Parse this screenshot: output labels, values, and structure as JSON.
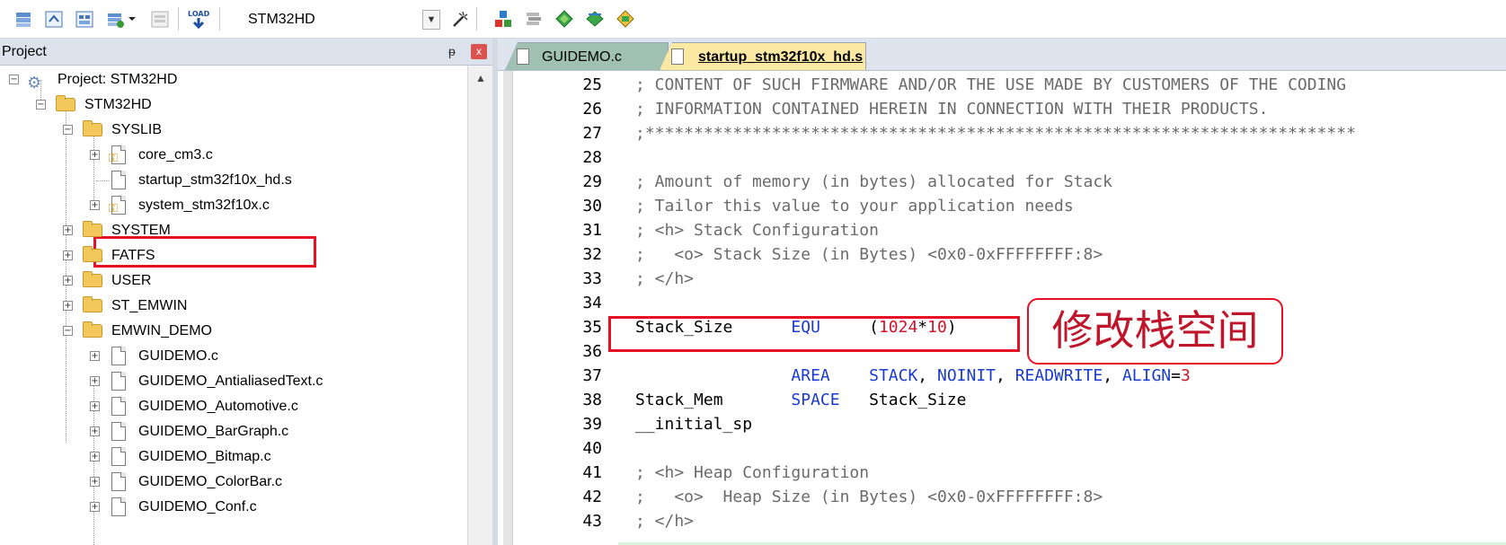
{
  "toolbar": {
    "target_name": "STM32HD",
    "load_label": "LOAD",
    "icons": [
      "batch-build-icon",
      "translate-icon",
      "build-icon",
      "rebuild-icon",
      "stop-build-icon",
      "download-icon",
      "options-wand-icon",
      "manage-components-icon",
      "manage-books-icon",
      "pack-installer-icon",
      "select-packs-icon",
      "run-time-env-icon"
    ]
  },
  "project_panel": {
    "title": "Project",
    "pin_glyph": "ᵽ",
    "close_glyph": "x",
    "tree": [
      {
        "label": "Project: STM32HD"
      },
      {
        "label": "STM32HD"
      },
      {
        "label": "SYSLIB"
      },
      {
        "label": "core_cm3.c"
      },
      {
        "label": "startup_stm32f10x_hd.s"
      },
      {
        "label": "system_stm32f10x.c"
      },
      {
        "label": "SYSTEM"
      },
      {
        "label": "FATFS"
      },
      {
        "label": "USER"
      },
      {
        "label": "ST_EMWIN"
      },
      {
        "label": "EMWIN_DEMO"
      },
      {
        "label": "GUIDEMO.c"
      },
      {
        "label": "GUIDEMO_AntialiasedText.c"
      },
      {
        "label": "GUIDEMO_Automotive.c"
      },
      {
        "label": "GUIDEMO_BarGraph.c"
      },
      {
        "label": "GUIDEMO_Bitmap.c"
      },
      {
        "label": "GUIDEMO_ColorBar.c"
      },
      {
        "label": "GUIDEMO_Conf.c"
      }
    ]
  },
  "tabs": [
    {
      "label": "GUIDEMO.c"
    },
    {
      "label": "startup_stm32f10x_hd.s"
    }
  ],
  "code_lines": [
    {
      "n": "25",
      "segs": [
        {
          "t": "; CONTENT OF SUCH FIRMWARE AND/OR THE USE MADE BY CUSTOMERS OF THE CODING",
          "c": "cmt"
        }
      ]
    },
    {
      "n": "26",
      "segs": [
        {
          "t": "; INFORMATION CONTAINED HEREIN IN CONNECTION WITH THEIR PRODUCTS.",
          "c": "cmt"
        }
      ]
    },
    {
      "n": "27",
      "segs": [
        {
          "t": ";*************************************************************************",
          "c": "cmt"
        }
      ]
    },
    {
      "n": "28",
      "segs": []
    },
    {
      "n": "29",
      "segs": [
        {
          "t": "; Amount of memory (in bytes) allocated for Stack",
          "c": "cmt"
        }
      ]
    },
    {
      "n": "30",
      "segs": [
        {
          "t": "; Tailor this value to your application needs",
          "c": "cmt"
        }
      ]
    },
    {
      "n": "31",
      "segs": [
        {
          "t": "; <h> Stack Configuration",
          "c": "cmt"
        }
      ]
    },
    {
      "n": "32",
      "segs": [
        {
          "t": ";   <o> Stack Size (in Bytes) <0x0-0xFFFFFFFF:8>",
          "c": "cmt"
        }
      ]
    },
    {
      "n": "33",
      "segs": [
        {
          "t": "; </h>",
          "c": "cmt"
        }
      ]
    },
    {
      "n": "34",
      "segs": []
    },
    {
      "n": "35",
      "segs": [
        {
          "t": "Stack_Size      ",
          "c": "plain"
        },
        {
          "t": "EQU",
          "c": "kw"
        },
        {
          "t": "     (",
          "c": "plain"
        },
        {
          "t": "1024",
          "c": "num"
        },
        {
          "t": "*",
          "c": "plain"
        },
        {
          "t": "10",
          "c": "num"
        },
        {
          "t": ")",
          "c": "plain"
        }
      ]
    },
    {
      "n": "36",
      "segs": []
    },
    {
      "n": "37",
      "segs": [
        {
          "t": "                ",
          "c": "plain"
        },
        {
          "t": "AREA",
          "c": "kw"
        },
        {
          "t": "    ",
          "c": "plain"
        },
        {
          "t": "STACK",
          "c": "kw"
        },
        {
          "t": ", ",
          "c": "plain"
        },
        {
          "t": "NOINIT",
          "c": "kw"
        },
        {
          "t": ", ",
          "c": "plain"
        },
        {
          "t": "READWRITE",
          "c": "kw"
        },
        {
          "t": ", ",
          "c": "plain"
        },
        {
          "t": "ALIGN",
          "c": "kw"
        },
        {
          "t": "=",
          "c": "plain"
        },
        {
          "t": "3",
          "c": "num"
        }
      ]
    },
    {
      "n": "38",
      "segs": [
        {
          "t": "Stack_Mem       ",
          "c": "plain"
        },
        {
          "t": "SPACE",
          "c": "kw"
        },
        {
          "t": "   Stack_Size",
          "c": "plain"
        }
      ]
    },
    {
      "n": "39",
      "segs": [
        {
          "t": "__initial_sp",
          "c": "plain"
        }
      ]
    },
    {
      "n": "40",
      "segs": []
    },
    {
      "n": "41",
      "segs": [
        {
          "t": "; <h> Heap Configuration",
          "c": "cmt"
        }
      ]
    },
    {
      "n": "42",
      "segs": [
        {
          "t": ";   <o>  Heap Size (in Bytes) <0x0-0xFFFFFFFF:8>",
          "c": "cmt"
        }
      ]
    },
    {
      "n": "43",
      "segs": [
        {
          "t": "; </h>",
          "c": "cmt"
        }
      ]
    }
  ],
  "annotation": {
    "text": "修改栈空间"
  },
  "colors": {
    "highlight_red": "#e81123",
    "keyword_blue": "#1a3bd1",
    "number_red": "#d3142a",
    "comment_gray": "#6b6b6b",
    "active_tab": "#fbe9a3"
  }
}
